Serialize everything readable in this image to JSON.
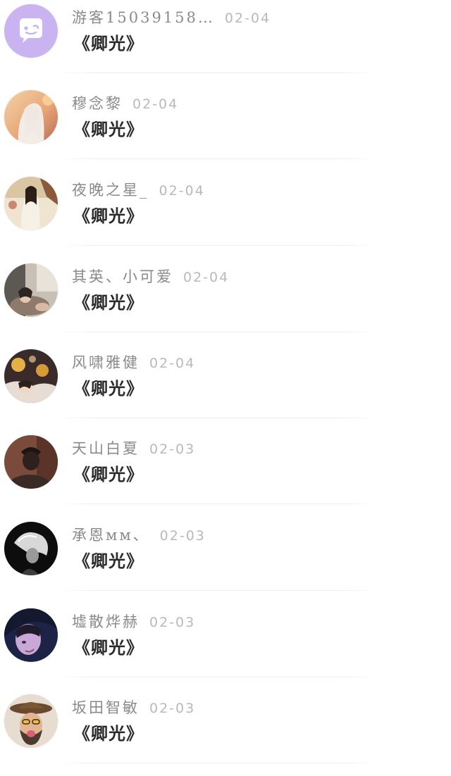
{
  "comments": [
    {
      "nickname": "游客15039158…",
      "date": "02-04",
      "message": "《卿光》",
      "avatar_icon": "ghost-chat-icon"
    },
    {
      "nickname": "穆念黎",
      "date": "02-04",
      "message": "《卿光》",
      "avatar_icon": "user-avatar"
    },
    {
      "nickname": "夜晚之星_",
      "date": "02-04",
      "message": "《卿光》",
      "avatar_icon": "user-avatar"
    },
    {
      "nickname": "其英、小可爱",
      "date": "02-04",
      "message": "《卿光》",
      "avatar_icon": "user-avatar"
    },
    {
      "nickname": "风啸雅健",
      "date": "02-04",
      "message": "《卿光》",
      "avatar_icon": "user-avatar"
    },
    {
      "nickname": "天山白夏",
      "date": "02-03",
      "message": "《卿光》",
      "avatar_icon": "user-avatar"
    },
    {
      "nickname": "承恩мм、",
      "date": "02-03",
      "message": "《卿光》",
      "avatar_icon": "user-avatar"
    },
    {
      "nickname": "墟散烨赫",
      "date": "02-03",
      "message": "《卿光》",
      "avatar_icon": "user-avatar"
    },
    {
      "nickname": "坂田智敏",
      "date": "02-03",
      "message": "《卿光》",
      "avatar_icon": "user-avatar"
    }
  ],
  "colors": {
    "nickname": "#8a8a8a",
    "date": "#b9b9b9",
    "message": "#2a2a2a",
    "divider": "#ececec",
    "guest_avatar": "#c9b3f0"
  }
}
